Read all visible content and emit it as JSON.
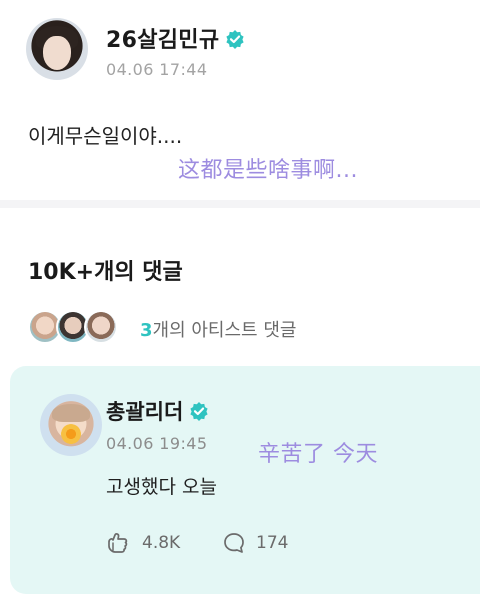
{
  "post": {
    "author": "26살김민규",
    "time": "04.06 17:44",
    "body": "이게무슨일이야....",
    "translation": "这都是些啥事啊..."
  },
  "comments": {
    "header": "10K+개의 댓글",
    "artist_count": "3",
    "artist_label": "개의 아티스트 댓글"
  },
  "comment": {
    "author": "총괄리더",
    "time": "04.06 19:45",
    "translation": "辛苦了 今天",
    "body": "고생했다 오늘",
    "likes": "4.8K",
    "replies": "174"
  },
  "colors": {
    "verified": "#2fc3c0",
    "accent": "#2fc3c0",
    "translation": "#9d8ce0",
    "card_bg": "#e4f7f5"
  },
  "icons": {
    "verified": "verified-badge-icon",
    "like": "like-hand-icon",
    "reply": "comment-bubble-icon"
  }
}
